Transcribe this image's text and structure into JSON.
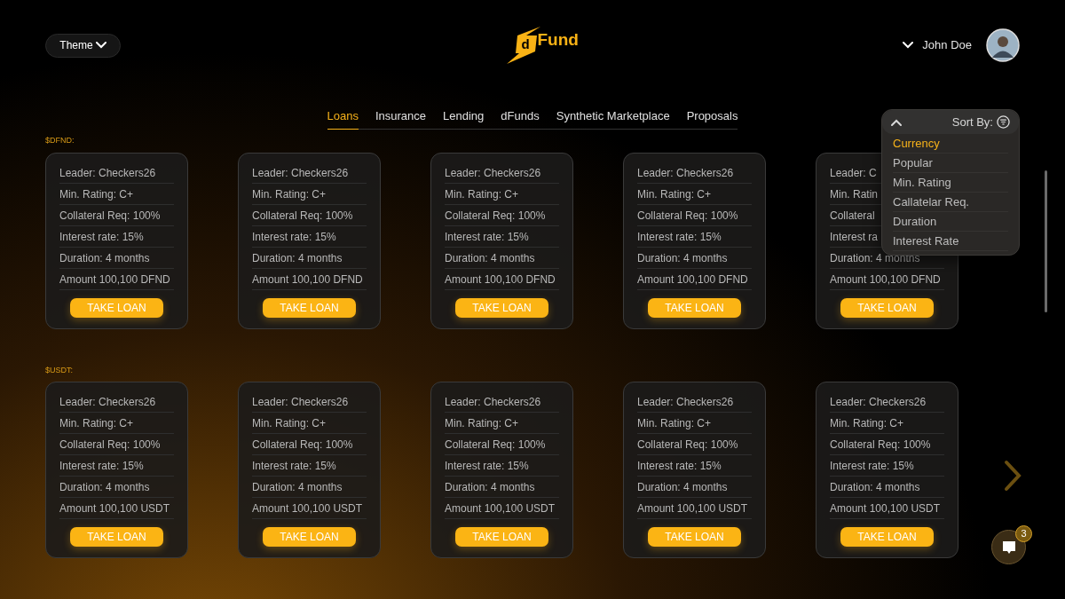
{
  "header": {
    "theme_button": "Theme",
    "logo": {
      "mark": "d",
      "name": "Fund"
    },
    "user": {
      "name": "John Doe"
    }
  },
  "tabs": [
    {
      "label": "Loans",
      "selected": true
    },
    {
      "label": "Insurance",
      "selected": false
    },
    {
      "label": "Lending",
      "selected": false
    },
    {
      "label": "dFunds",
      "selected": false
    },
    {
      "label": "Synthetic Marketplace",
      "selected": false
    },
    {
      "label": "Proposals",
      "selected": false
    }
  ],
  "sort": {
    "label": "Sort By:",
    "expanded": true,
    "options": [
      {
        "label": "Currency",
        "selected": true
      },
      {
        "label": "Popular",
        "selected": false
      },
      {
        "label": "Min. Rating",
        "selected": false
      },
      {
        "label": "Callatelar Req.",
        "selected": false
      },
      {
        "label": "Duration",
        "selected": false
      },
      {
        "label": "Interest Rate",
        "selected": false
      }
    ]
  },
  "sections": [
    {
      "label": "$DFND:",
      "cards": [
        {
          "lines": [
            "Leader: Checkers26",
            "Min. Rating: C+",
            "Collateral Req: 100%",
            "Interest rate: 15%",
            "Duration: 4 months",
            "Amount 100,100 DFND"
          ],
          "button": "TAKE LOAN"
        },
        {
          "lines": [
            "Leader: Checkers26",
            "Min. Rating: C+",
            "Collateral Req: 100%",
            "Interest rate: 15%",
            "Duration: 4 months",
            "Amount 100,100 DFND"
          ],
          "button": "TAKE LOAN"
        },
        {
          "lines": [
            "Leader: Checkers26",
            "Min. Rating: C+",
            "Collateral Req: 100%",
            "Interest rate: 15%",
            "Duration: 4 months",
            "Amount 100,100 DFND"
          ],
          "button": "TAKE LOAN"
        },
        {
          "lines": [
            "Leader: Checkers26",
            "Min. Rating: C+",
            "Collateral Req: 100%",
            "Interest rate: 15%",
            "Duration: 4 months",
            "Amount 100,100 DFND"
          ],
          "button": "TAKE LOAN"
        },
        {
          "lines": [
            "Leader: C",
            "Min. Ratin",
            "Collateral",
            "Interest ra",
            "Duration: 4 months",
            "Amount 100,100 DFND"
          ],
          "button": "TAKE LOAN"
        }
      ]
    },
    {
      "label": "$USDT:",
      "cards": [
        {
          "lines": [
            "Leader: Checkers26",
            "Min. Rating: C+",
            "Collateral Req: 100%",
            "Interest rate: 15%",
            "Duration: 4 months",
            "Amount 100,100 USDT"
          ],
          "button": "TAKE LOAN"
        },
        {
          "lines": [
            "Leader: Checkers26",
            "Min. Rating: C+",
            "Collateral Req: 100%",
            "Interest rate: 15%",
            "Duration: 4 months",
            "Amount 100,100 USDT"
          ],
          "button": "TAKE LOAN"
        },
        {
          "lines": [
            "Leader: Checkers26",
            "Min. Rating: C+",
            "Collateral Req: 100%",
            "Interest rate: 15%",
            "Duration: 4 months",
            "Amount 100,100 USDT"
          ],
          "button": "TAKE LOAN"
        },
        {
          "lines": [
            "Leader: Checkers26",
            "Min. Rating: C+",
            "Collateral Req: 100%",
            "Interest rate: 15%",
            "Duration: 4 months",
            "Amount 100,100 USDT"
          ],
          "button": "TAKE LOAN"
        },
        {
          "lines": [
            "Leader: Checkers26",
            "Min. Rating: C+",
            "Collateral Req: 100%",
            "Interest rate: 15%",
            "Duration: 4 months",
            "Amount 100,100 USDT"
          ],
          "button": "TAKE LOAN"
        }
      ]
    }
  ],
  "chat": {
    "badge": "3"
  }
}
